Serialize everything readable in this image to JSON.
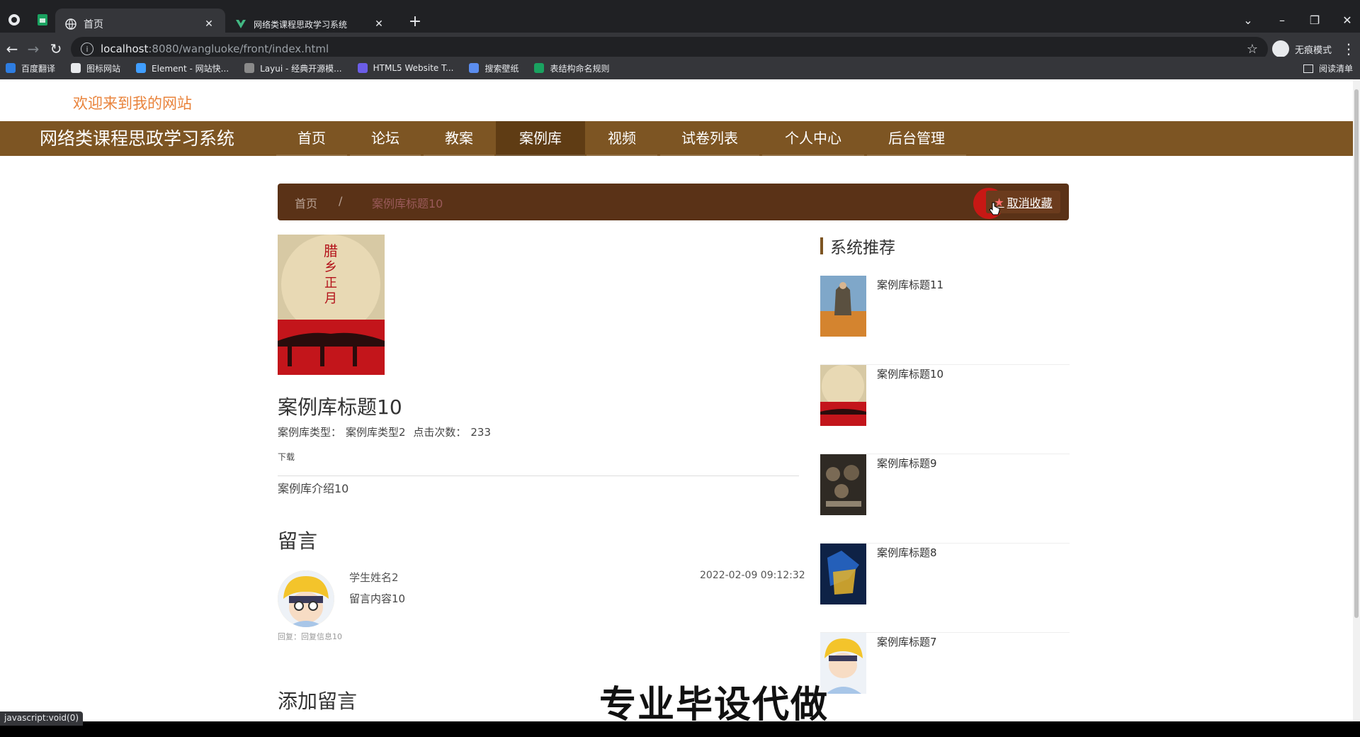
{
  "browser": {
    "tabs": [
      {
        "title": "首页",
        "active": true
      },
      {
        "title": "网络类课程思政学习系统",
        "active": false
      }
    ],
    "url_host": "localhost",
    "url_path": ":8080/wangluoke/front/index.html",
    "profile_label": "无痕模式",
    "bookmarks": [
      "百度翻译",
      "图标网站",
      "Element - 网站快...",
      "Layui - 经典开源模...",
      "HTML5 Website T...",
      "搜索壁纸",
      "表结构命名规则"
    ],
    "reading_list": "阅读清单",
    "status_url": "javascript:void(0)"
  },
  "header": {
    "welcome": "欢迎来到我的网站",
    "site_title": "网络类课程思政学习系统",
    "nav": [
      "首页",
      "论坛",
      "教案",
      "案例库",
      "视频",
      "试卷列表",
      "个人中心",
      "后台管理"
    ],
    "active_nav": "案例库"
  },
  "breadcrumb": {
    "home": "首页",
    "separator": "/",
    "current": "案例库标题10",
    "favorite_button": "取消收藏"
  },
  "detail": {
    "title": "案例库标题10",
    "type_label": "案例库类型：",
    "type_value": "案例库类型2",
    "clicks_label": "点击次数：",
    "clicks_value": "233",
    "download": "下载",
    "intro": "案例库介绍10"
  },
  "comments": {
    "heading": "留言",
    "items": [
      {
        "name": "学生姓名2",
        "content": "留言内容10",
        "time": "2022-02-09 09:12:32",
        "reply": "回复：回复信息10"
      }
    ],
    "add_heading": "添加留言"
  },
  "sidebar": {
    "title": "系统推荐",
    "items": [
      {
        "title": "案例库标题11"
      },
      {
        "title": "案例库标题10"
      },
      {
        "title": "案例库标题9"
      },
      {
        "title": "案例库标题8"
      },
      {
        "title": "案例库标题7"
      }
    ]
  },
  "overlay": {
    "watermark": "专业毕设代做"
  },
  "colors": {
    "brand": "#7d5523",
    "nav_active": "#5f3c14",
    "breadcrumb_bg": "#5a3217",
    "welcome": "#e9833b"
  }
}
